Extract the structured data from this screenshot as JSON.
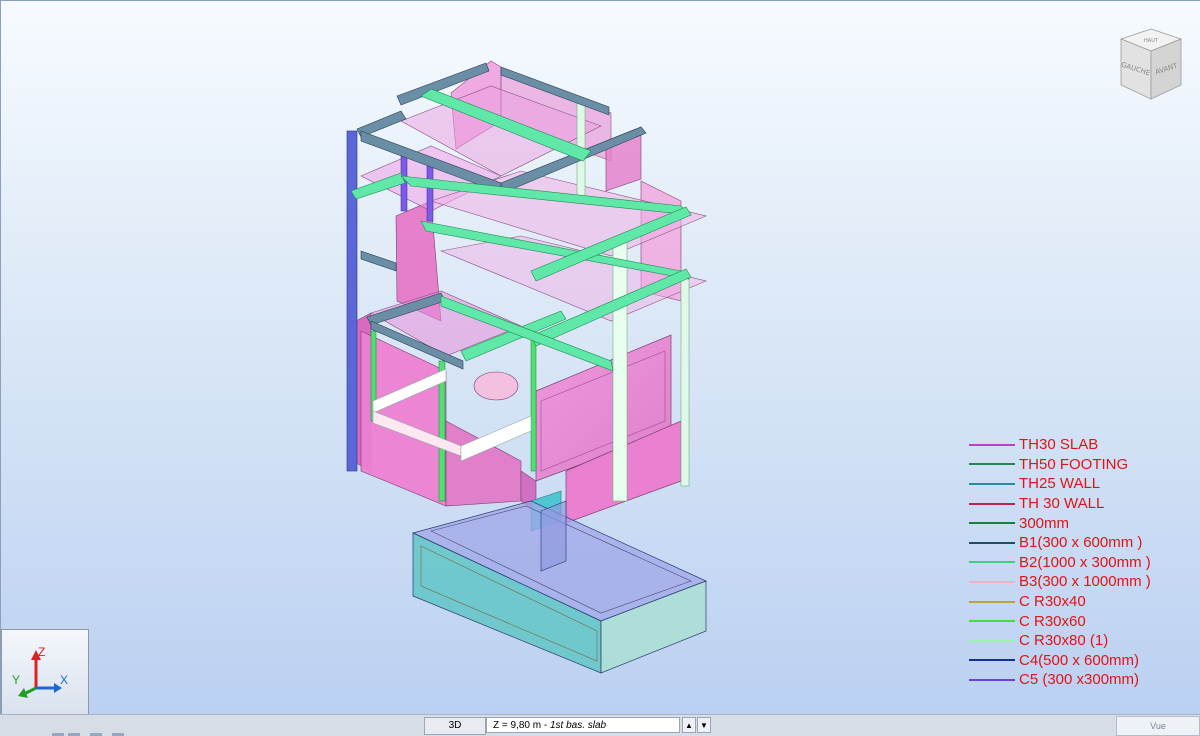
{
  "view_cube": {
    "top_label": "HAUT",
    "left_label": "GAUCHE",
    "right_label": "AVANT"
  },
  "axes": {
    "z": "Z",
    "y": "Y",
    "x": "X"
  },
  "legend": [
    {
      "label": "TH30 SLAB",
      "color": "#c040c0"
    },
    {
      "label": "TH50 FOOTING",
      "color": "#1f8a4a"
    },
    {
      "label": "TH25 WALL",
      "color": "#2a8aa0"
    },
    {
      "label": "TH 30 WALL",
      "color": "#c02050"
    },
    {
      "label": "300mm",
      "color": "#1a8040"
    },
    {
      "label": "B1(300 x 600mm )",
      "color": "#1e5060"
    },
    {
      "label": "B2(1000 x 300mm )",
      "color": "#40d080"
    },
    {
      "label": "B3(300 x 1000mm )",
      "color": "#f0b0c8"
    },
    {
      "label": "C R30x40",
      "color": "#c0a030"
    },
    {
      "label": "C R30x60",
      "color": "#40e040"
    },
    {
      "label": "C R30x80 (1)",
      "color": "#a0f0b0"
    },
    {
      "label": "C4(500 x 600mm)",
      "color": "#1a2e90"
    },
    {
      "label": "C5 (300 x300mm)",
      "color": "#6a40e0"
    }
  ],
  "statusbar": {
    "view_mode": "3D",
    "plane_prefix": "Z = 9,80 m - ",
    "plane_name": "1st bas. slab",
    "spin_up": "▲",
    "spin_down": "▼",
    "vue_tab": "Vue"
  }
}
